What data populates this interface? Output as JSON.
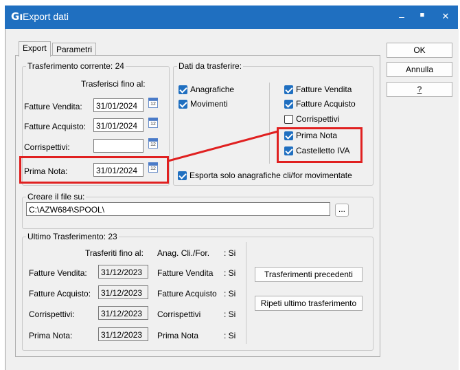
{
  "window": {
    "title": "Export dati",
    "icon": "Gı",
    "minimize": "–",
    "maximize": "■",
    "close": "✕"
  },
  "tabs": [
    {
      "label": "Export"
    },
    {
      "label": "Parametri"
    }
  ],
  "buttons": {
    "ok": "OK",
    "annulla": "Annulla",
    "help": "?"
  },
  "trasferimento_corrente": {
    "title": "Trasferimento corrente: 24",
    "header": "Trasferisci fino al:",
    "fatture_vendita": {
      "label": "Fatture Vendita:",
      "value": "31/01/2024"
    },
    "fatture_acquisto": {
      "label": "Fatture Acquisto:",
      "value": "31/01/2024"
    },
    "corrispettivi": {
      "label": "Corrispettivi:",
      "value": ""
    },
    "prima_nota": {
      "label": "Prima Nota:",
      "value": "31/01/2024"
    },
    "calendar_glyph": "12"
  },
  "dati_da_trasferire": {
    "title": "Dati da trasferire:",
    "anagrafiche": {
      "label": "Anagrafiche",
      "checked": true
    },
    "movimenti": {
      "label": "Movimenti",
      "checked": true
    },
    "fatture_vendita": {
      "label": "Fatture Vendita",
      "checked": true
    },
    "fatture_acquisto": {
      "label": "Fatture Acquisto",
      "checked": true
    },
    "corrispettivi": {
      "label": "Corrispettivi",
      "checked": false
    },
    "prima_nota": {
      "label": "Prima Nota",
      "checked": true
    },
    "castelletto_iva": {
      "label": "Castelletto IVA",
      "checked": true
    },
    "esporta_solo": {
      "label": "Esporta solo anagrafiche cli/for movimentate",
      "checked": true
    }
  },
  "file": {
    "title": "Creare il file su:",
    "path": "C:\\AZW684\\SPOOL\\",
    "browse": "..."
  },
  "ultimo_trasferimento": {
    "title": "Ultimo Trasferimento: 23",
    "header": "Trasferiti fino al:",
    "anag_header": "Anag. Cli./For.",
    "rows": [
      {
        "label": "Fatture Vendita:",
        "value": "31/12/2023",
        "type": "Fatture Vendita",
        "flag": ": Si"
      },
      {
        "label": "Fatture Acquisto:",
        "value": "31/12/2023",
        "type": "Fatture Acquisto",
        "flag": ": Si"
      },
      {
        "label": "Corrispettivi:",
        "value": "31/12/2023",
        "type": "Corrispettivi",
        "flag": ": Si"
      },
      {
        "label": "Prima Nota:",
        "value": "31/12/2023",
        "type": "Prima Nota",
        "flag": ": Si"
      }
    ],
    "anag_flag": ": Si",
    "btn_precedenti": "Trasferimenti precedenti",
    "btn_ripeti": "Ripeti ultimo trasferimento"
  },
  "colors": {
    "titlebar": "#1f6fc0",
    "highlight": "#e02020",
    "checkbox": "#1f6fc0"
  }
}
